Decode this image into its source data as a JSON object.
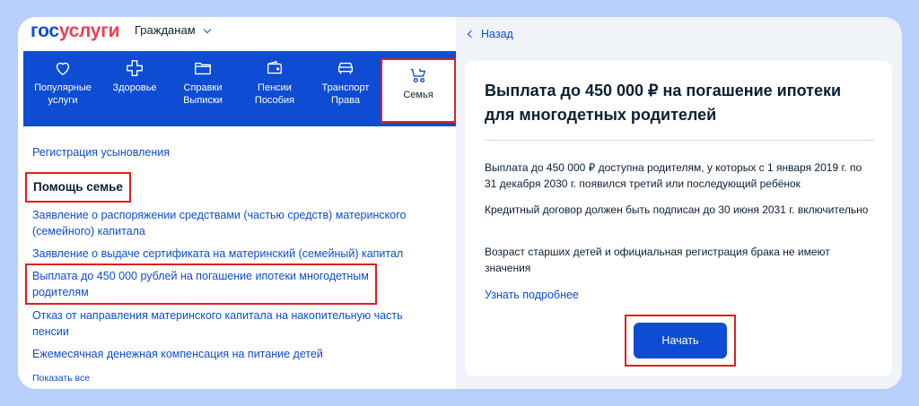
{
  "header": {
    "logo_part1": "гос",
    "logo_part2": "услуги",
    "audience": "Гражданам"
  },
  "categories": [
    {
      "label": "Популярные\nуслуги",
      "icon": "heart-icon"
    },
    {
      "label": "Здоровье",
      "icon": "plus-cross-icon"
    },
    {
      "label": "Справки\nВыписки",
      "icon": "folder-icon"
    },
    {
      "label": "Пенсии\nПособия",
      "icon": "wallet-icon"
    },
    {
      "label": "Транспорт\nПрава",
      "icon": "car-icon"
    },
    {
      "label": "Семья",
      "icon": "baby-stroller-icon"
    }
  ],
  "family_section": {
    "adoption_link": "Регистрация усыновления",
    "title": "Помощь семье",
    "links": [
      "Заявление о распоряжении средствами (частью средств) материнского (семейного) капитала",
      "Заявление о выдаче сертификата на материнский (семейный) капитал",
      "Выплата до 450 000 рублей на погашение ипотеки многодетным родителям",
      "Отказ от направления материнского капитала на накопительную часть пенсии",
      "Ежемесячная денежная компенсация на питание детей"
    ],
    "show_all": "Показать все"
  },
  "detail": {
    "back": "Назад",
    "title": "Выплата до 450 000 ₽ на погашение ипотеки для многодетных родителей",
    "paragraphs": [
      "Выплата до 450 000 ₽ доступна родителям, у которых с 1 января 2019 г. по 31 декабря 2030 г. появился третий или последующий ребёнок",
      "Кредитный договор должен быть подписан до 30 июня 2031 г. включительно",
      "Возраст старших детей и официальная регистрация брака не имеют значения"
    ],
    "more": "Узнать подробнее",
    "start": "Начать"
  },
  "colors": {
    "brand_blue": "#0d4cd3",
    "brand_red": "#ee3f58",
    "highlight": "#e0201e",
    "background": "#b8cffc"
  }
}
